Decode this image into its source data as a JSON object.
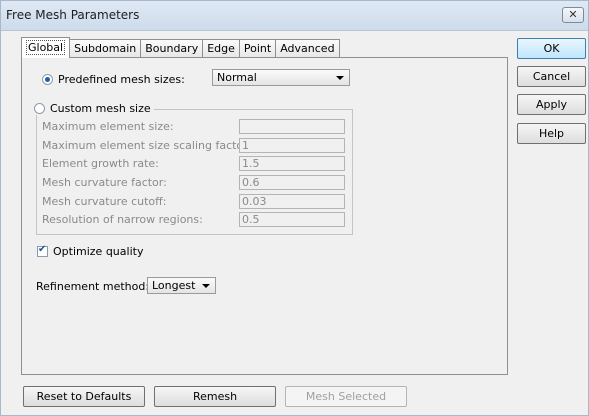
{
  "window": {
    "title": "Free Mesh Parameters",
    "close_icon": "close-icon"
  },
  "tabs": [
    "Global",
    "Subdomain",
    "Boundary",
    "Edge",
    "Point",
    "Advanced"
  ],
  "global": {
    "predefined_label": "Predefined mesh sizes:",
    "predefined_value": "Normal",
    "custom_label": "Custom mesh size",
    "fields": [
      {
        "label": "Maximum element size:",
        "value": ""
      },
      {
        "label": "Maximum element size scaling factor:",
        "value": "1"
      },
      {
        "label": "Element growth rate:",
        "value": "1.5"
      },
      {
        "label": "Mesh curvature factor:",
        "value": "0.6"
      },
      {
        "label": "Mesh curvature cutoff:",
        "value": "0.03"
      },
      {
        "label": "Resolution of narrow regions:",
        "value": "0.5"
      }
    ],
    "optimize_label": "Optimize quality",
    "optimize_checked": true,
    "refinement_label": "Refinement method:",
    "refinement_value": "Longest"
  },
  "side_buttons": {
    "ok": "OK",
    "cancel": "Cancel",
    "apply": "Apply",
    "help": "Help"
  },
  "bottom_buttons": {
    "reset": "Reset to Defaults",
    "remesh": "Remesh",
    "mesh_selected": "Mesh Selected"
  }
}
